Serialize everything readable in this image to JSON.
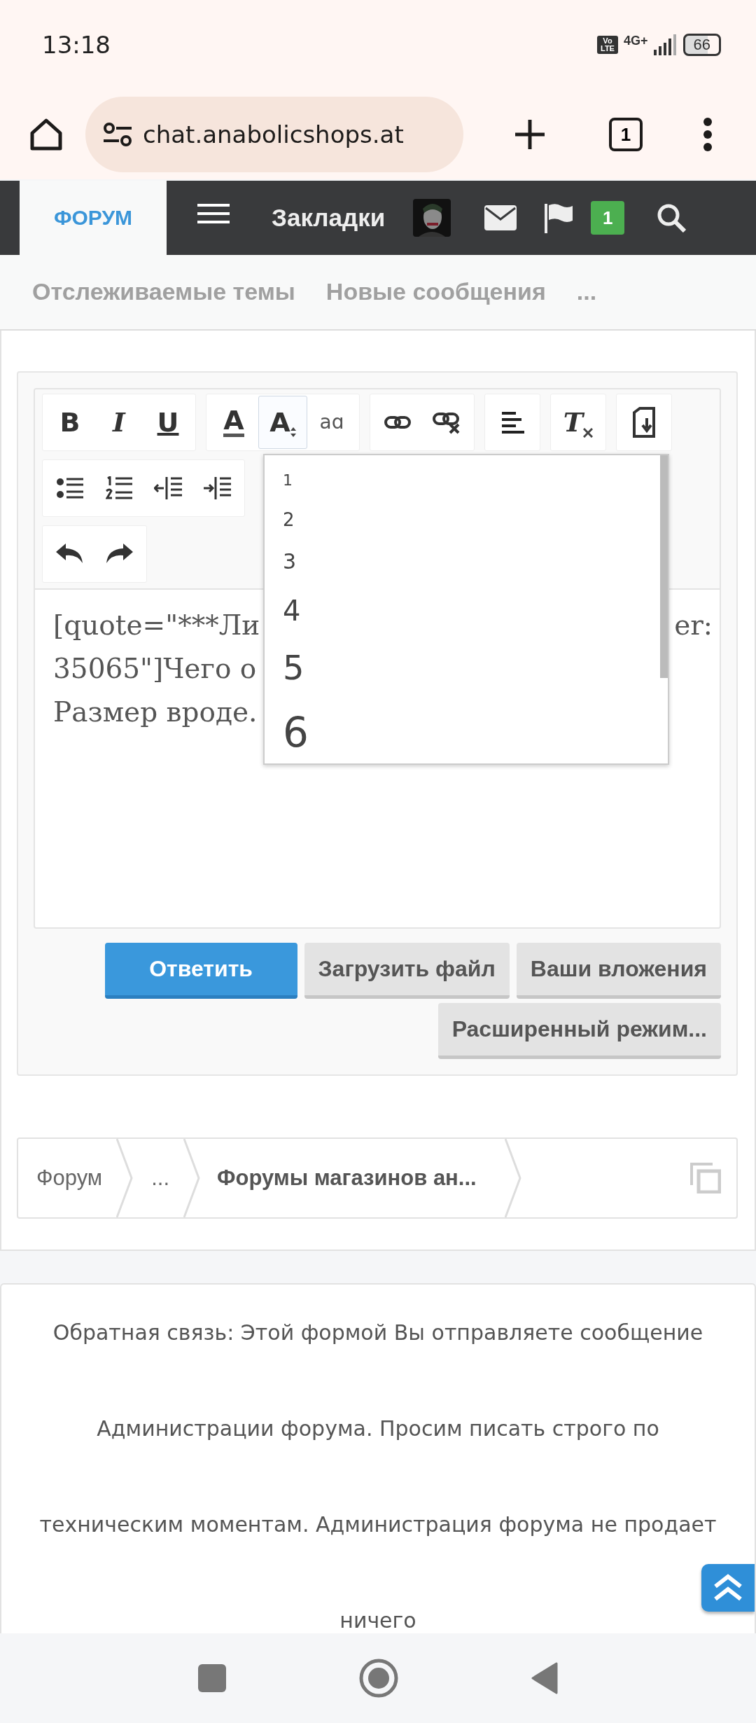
{
  "status_bar": {
    "time": "13:18",
    "volte": "Vo LTE",
    "network": "4G+",
    "battery": "66"
  },
  "browser": {
    "url": "chat.anabolicshops.at",
    "tab_count": "1"
  },
  "nav": {
    "items": [
      {
        "kind": "tab",
        "label": "ФОРУМ",
        "selected": true
      },
      {
        "kind": "menu"
      },
      {
        "kind": "link",
        "label": "Закладки"
      },
      {
        "kind": "avatar"
      },
      {
        "kind": "mail"
      },
      {
        "kind": "flag"
      },
      {
        "kind": "badge",
        "label": "1"
      },
      {
        "kind": "search"
      }
    ]
  },
  "subnav": {
    "links": [
      "Отслеживаемые темы",
      "Новые сообщения",
      "..."
    ]
  },
  "editor": {
    "toolbar_rows": [
      [
        [
          {
            "kind": "bold",
            "glyph": "B",
            "active": false
          },
          {
            "kind": "italic",
            "glyph": "I",
            "active": false
          },
          {
            "kind": "underline",
            "glyph": "U",
            "active": false
          }
        ],
        [
          {
            "kind": "color",
            "glyph": "A",
            "active": false
          },
          {
            "kind": "fontsize",
            "glyph": "A",
            "active": true
          },
          {
            "kind": "case",
            "glyph": "aɑ",
            "active": false
          }
        ],
        [
          {
            "kind": "link",
            "active": false
          },
          {
            "kind": "unlink",
            "active": false
          }
        ],
        [
          {
            "kind": "align",
            "active": false
          }
        ],
        [
          {
            "kind": "clear",
            "glyph": "T",
            "active": false
          }
        ],
        [
          {
            "kind": "source",
            "active": false
          }
        ]
      ],
      [
        [
          {
            "kind": "bullets",
            "active": false
          },
          {
            "kind": "numbers",
            "active": false
          },
          {
            "kind": "outdent",
            "active": false
          },
          {
            "kind": "indent",
            "active": false
          }
        ]
      ],
      [
        [
          {
            "kind": "undo",
            "active": false
          },
          {
            "kind": "redo",
            "active": false
          }
        ]
      ]
    ],
    "text_lines": [
      {
        "left": "[quote=\"***Ли",
        "right": "er:"
      },
      {
        "left": "35065\"]Чего о"
      },
      {
        "left": "Размер вроде."
      }
    ],
    "size_menu": {
      "options": [
        "1",
        "2",
        "3",
        "4",
        "5",
        "6"
      ]
    },
    "buttons": [
      {
        "label": "Ответить",
        "kind": "primary"
      },
      {
        "label": "Загрузить файл",
        "kind": "secondary"
      },
      {
        "label": "Ваши вложения",
        "kind": "secondary"
      },
      {
        "label": "Расширенный режим...",
        "kind": "secondary"
      }
    ]
  },
  "breadcrumb": [
    {
      "label": "Форум",
      "current": false
    },
    {
      "label": "...",
      "current": false
    },
    {
      "label": "Форумы магазинов ан...",
      "current": true
    }
  ],
  "footer": {
    "lines": [
      "Обратная связь: Этой формой Вы отправляете сообщение",
      "Администрации форума. Просим писать строго по",
      "техническим моментам. Администрация форума не продает",
      "ничего"
    ]
  }
}
